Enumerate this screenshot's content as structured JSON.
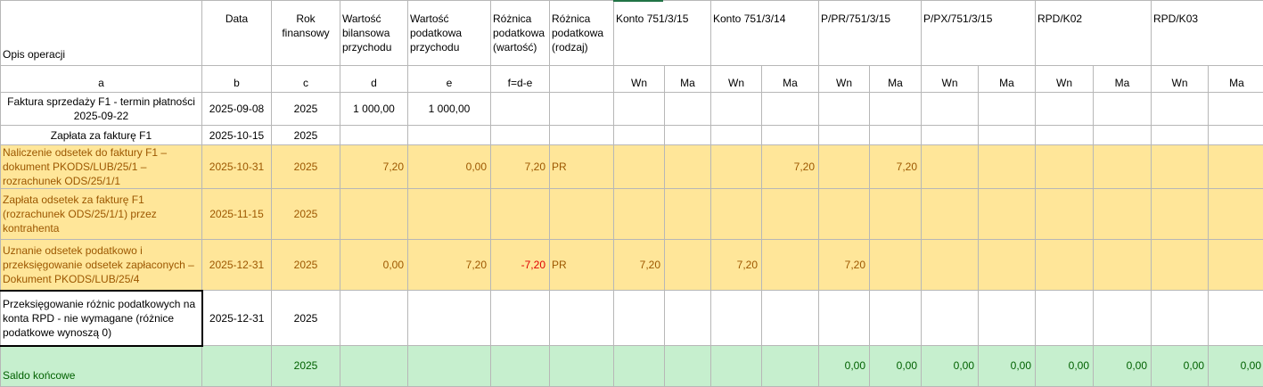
{
  "header": {
    "opis": "Opis operacji",
    "data": "Data",
    "rok": "Rok finansowy",
    "wart_bil": "Wartość bilansowa przychodu",
    "wart_pod": "Wartość podatkowa przychodu",
    "roz_wart": "Różnica podatkowa (wartość)",
    "roz_rodz": "Różnica podatkowa (rodzaj)",
    "konto1": "Konto 751/3/15",
    "konto2": "Konto 751/3/14",
    "konto3": "P/PR/751/3/15",
    "konto4": "P/PX/751/3/15",
    "konto5": "RPD/K02",
    "konto6": "RPD/K03"
  },
  "subheader": {
    "a": "a",
    "b": "b",
    "c": "c",
    "d": "d",
    "e": "e",
    "f": "f=d-e",
    "wn": "Wn",
    "ma": "Ma"
  },
  "rows": [
    {
      "opis": "Faktura sprzedaży F1 - termin płatności 2025-09-22",
      "data": "2025-09-08",
      "rok": "2025",
      "d": "1 000,00",
      "e": "1 000,00"
    },
    {
      "opis": "Zapłata za fakturę F1",
      "data": "2025-10-15",
      "rok": "2025"
    },
    {
      "opis": "Naliczenie odsetek do faktury F1 – dokument PKODS/LUB/25/1 – rozrachunek ODS/25/1/1",
      "data": "2025-10-31",
      "rok": "2025",
      "d": "7,20",
      "e": "0,00",
      "f": "7,20",
      "rodzaj": "PR",
      "k2_ma": "7,20",
      "k3_ma": "7,20"
    },
    {
      "opis": "Zapłata odsetek za fakturę F1 (rozrachunek ODS/25/1/1) przez kontrahenta",
      "data": "2025-11-15",
      "rok": "2025"
    },
    {
      "opis": "Uznanie odsetek podatkowo i przeksięgowanie odsetek zapłaconych – Dokument PKODS/LUB/25/4",
      "data": "2025-12-31",
      "rok": "2025",
      "d": "0,00",
      "e": "7,20",
      "f": "-7,20",
      "rodzaj": "PR",
      "k1_wn": "7,20",
      "k2_wn": "7,20",
      "k3_wn": "7,20"
    },
    {
      "opis": "Przeksięgowanie różnic podatkowych na konta RPD - nie wymagane (różnice podatkowe wynoszą 0)",
      "data": "2025-12-31",
      "rok": "2025"
    }
  ],
  "saldo": {
    "opis": "Saldo końcowe",
    "rok": "2025",
    "k3_wn": "0,00",
    "k3_ma": "0,00",
    "k4_wn": "0,00",
    "k4_ma": "0,00",
    "k5_wn": "0,00",
    "k5_ma": "0,00",
    "k6_wn": "0,00",
    "k6_ma": "0,00"
  },
  "colors": {
    "yellow_bg": "#ffe699",
    "yellow_text": "#9c5700",
    "green_bg": "#c6efce",
    "green_text": "#006100",
    "negative": "#e00000"
  }
}
